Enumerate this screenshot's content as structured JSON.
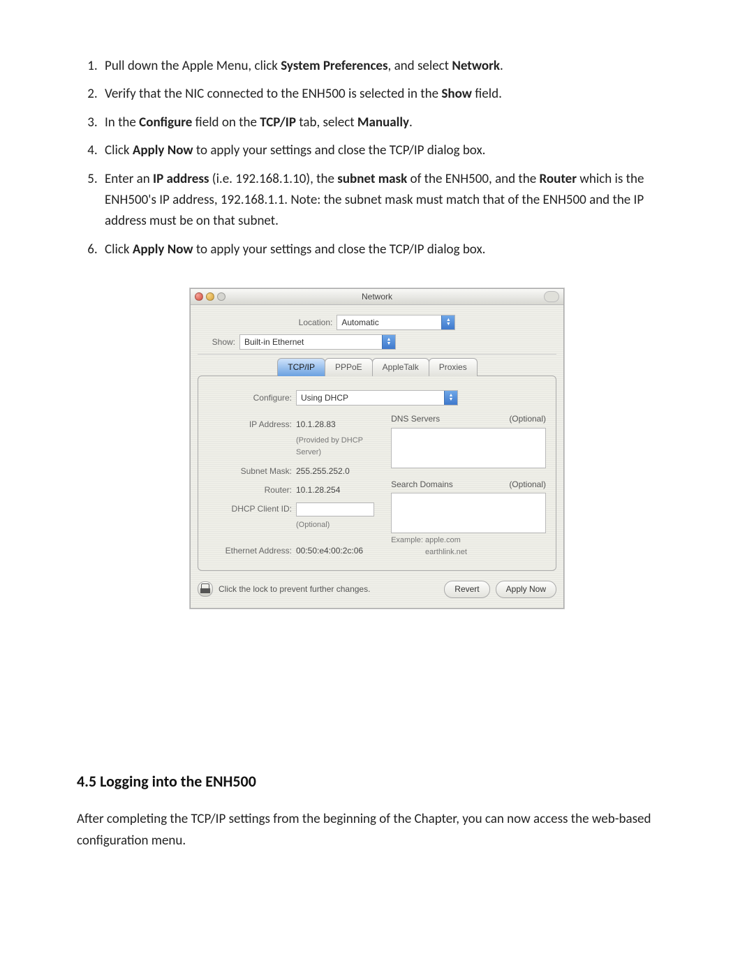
{
  "instructions": {
    "i1_a": "Pull down the Apple Menu, click ",
    "i1_b": "System Preferences",
    "i1_c": ", and select ",
    "i1_d": "Network",
    "i1_e": ".",
    "i2_a": "Verify that the NIC connected to the ENH500 is selected in the ",
    "i2_b": "Show",
    "i2_c": " field.",
    "i3_a": "In the ",
    "i3_b": "Configure",
    "i3_c": " field on the ",
    "i3_d": "TCP/IP",
    "i3_e": " tab, select ",
    "i3_f": "Manually",
    "i3_g": ".",
    "i4_a": "Click ",
    "i4_b": "Apply Now",
    "i4_c": " to apply your settings and close the TCP/IP dialog box.",
    "i5_a": "Enter an ",
    "i5_b": "IP address",
    "i5_c": " (i.e. 192.168.1.10), the ",
    "i5_d": "subnet mask",
    "i5_e": " of the ENH500, and the ",
    "i5_f": "Router",
    "i5_g": " which is the ENH500's IP address, 192.168.1.1.   Note: the subnet mask must match that of the ENH500 and the IP address must be on that subnet.",
    "i6_a": "Click ",
    "i6_b": "Apply Now",
    "i6_c": " to apply your settings and close the TCP/IP dialog box."
  },
  "window": {
    "title": "Network",
    "location_label": "Location:",
    "location_value": "Automatic",
    "show_label": "Show:",
    "show_value": "Built-in Ethernet",
    "tabs": {
      "tcpip": "TCP/IP",
      "pppoe": "PPPoE",
      "appletalk": "AppleTalk",
      "proxies": "Proxies"
    },
    "configure_label": "Configure:",
    "configure_value": "Using DHCP",
    "ip_label": "IP Address:",
    "ip_value": "10.1.28.83",
    "ip_sub": "(Provided by DHCP Server)",
    "subnet_label": "Subnet Mask:",
    "subnet_value": "255.255.252.0",
    "router_label": "Router:",
    "router_value": "10.1.28.254",
    "dhcp_client_label": "DHCP Client ID:",
    "dhcp_client_sub": "(Optional)",
    "eth_label": "Ethernet Address:",
    "eth_value": "00:50:e4:00:2c:06",
    "dns_label": "DNS Servers",
    "optional": "(Optional)",
    "search_label": "Search Domains",
    "example_label": "Example:",
    "example_value": "apple.com\nearthlink.net",
    "lock_msg": "Click the lock to prevent further changes.",
    "revert": "Revert",
    "apply_now": "Apply Now"
  },
  "section": {
    "heading": "4.5 Logging into the ENH500",
    "body": "After completing the TCP/IP settings from the beginning of the Chapter, you can now access the web-based configuration menu."
  }
}
